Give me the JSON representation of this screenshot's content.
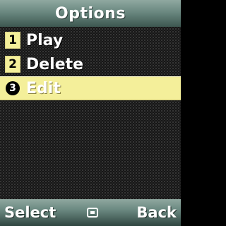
{
  "header": {
    "title": "Options"
  },
  "menu": {
    "items": [
      {
        "number": "1",
        "label": "Play",
        "selected": false
      },
      {
        "number": "2",
        "label": "Delete",
        "selected": false
      },
      {
        "number": "3",
        "label": "Edit",
        "selected": true
      }
    ]
  },
  "softkeys": {
    "left": "Select",
    "center_icon": "ok-square-icon",
    "right": "Back"
  },
  "colors": {
    "bar": "#6a8880",
    "highlight": "#f4ef9a",
    "text": "#ffffff"
  }
}
